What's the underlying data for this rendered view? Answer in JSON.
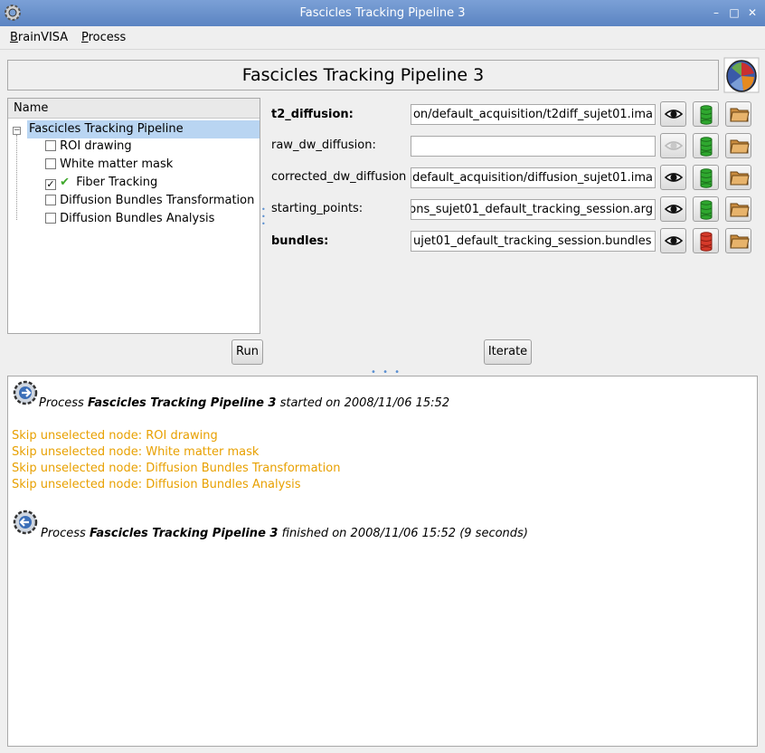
{
  "window": {
    "title": "Fascicles Tracking Pipeline 3"
  },
  "menu": [
    {
      "mnemonic": "B",
      "rest": "rainVISA"
    },
    {
      "mnemonic": "P",
      "rest": "rocess"
    }
  ],
  "header": {
    "title": "Fascicles Tracking Pipeline 3"
  },
  "tree": {
    "column_header": "Name",
    "root": {
      "label": "Fascicles Tracking Pipeline",
      "expander": "−"
    },
    "items": [
      {
        "label": "ROI drawing",
        "checked": ""
      },
      {
        "label": "White matter mask",
        "checked": ""
      },
      {
        "label": "Fiber Tracking",
        "checked": "✓"
      },
      {
        "label": "Diffusion Bundles Transformation",
        "checked": ""
      },
      {
        "label": "Diffusion Bundles Analysis",
        "checked": ""
      }
    ]
  },
  "params": [
    {
      "label": "t2_diffusion:",
      "bold": true,
      "value": "on/default_acquisition/t2diff_sujet01.ima",
      "eye_enabled": true,
      "db_status": "green"
    },
    {
      "label": "raw_dw_diffusion:",
      "bold": false,
      "value": "",
      "eye_enabled": false,
      "db_status": "green"
    },
    {
      "label": "corrected_dw_diffusion",
      "bold": false,
      "value": "default_acquisition/diffusion_sujet01.ima",
      "eye_enabled": true,
      "db_status": "green"
    },
    {
      "label": "starting_points:",
      "bold": false,
      "value": "ons_sujet01_default_tracking_session.arg",
      "eye_enabled": true,
      "db_status": "green"
    },
    {
      "label": "bundles:",
      "bold": true,
      "value": "ujet01_default_tracking_session.bundles",
      "eye_enabled": true,
      "db_status": "red"
    }
  ],
  "buttons": {
    "run": "Run",
    "iterate": "Iterate"
  },
  "log": {
    "start": {
      "prefix": "Process ",
      "name": "Fascicles Tracking Pipeline 3",
      "suffix": " started on 2008/11/06 15:52"
    },
    "skips": [
      "Skip unselected node: ROI drawing",
      "Skip unselected node: White matter mask",
      "Skip unselected node: Diffusion Bundles Transformation",
      "Skip unselected node: Diffusion Bundles Analysis"
    ],
    "end": {
      "prefix": "Process ",
      "name": "Fascicles Tracking Pipeline 3",
      "suffix": " finished on 2008/11/06 15:52 (9 seconds)"
    }
  },
  "icons": {
    "window_icon": "gear-icon",
    "eye": "eye-icon",
    "db_green": "database-green-icon",
    "db_red": "database-red-icon",
    "browse": "folder-browse-icon",
    "brain": "brain-logo-icon"
  },
  "colors": {
    "selection": "#b9d5f2",
    "titlebar": "#6a92cc",
    "warning": "#e8a000",
    "check": "#3fa82c"
  }
}
